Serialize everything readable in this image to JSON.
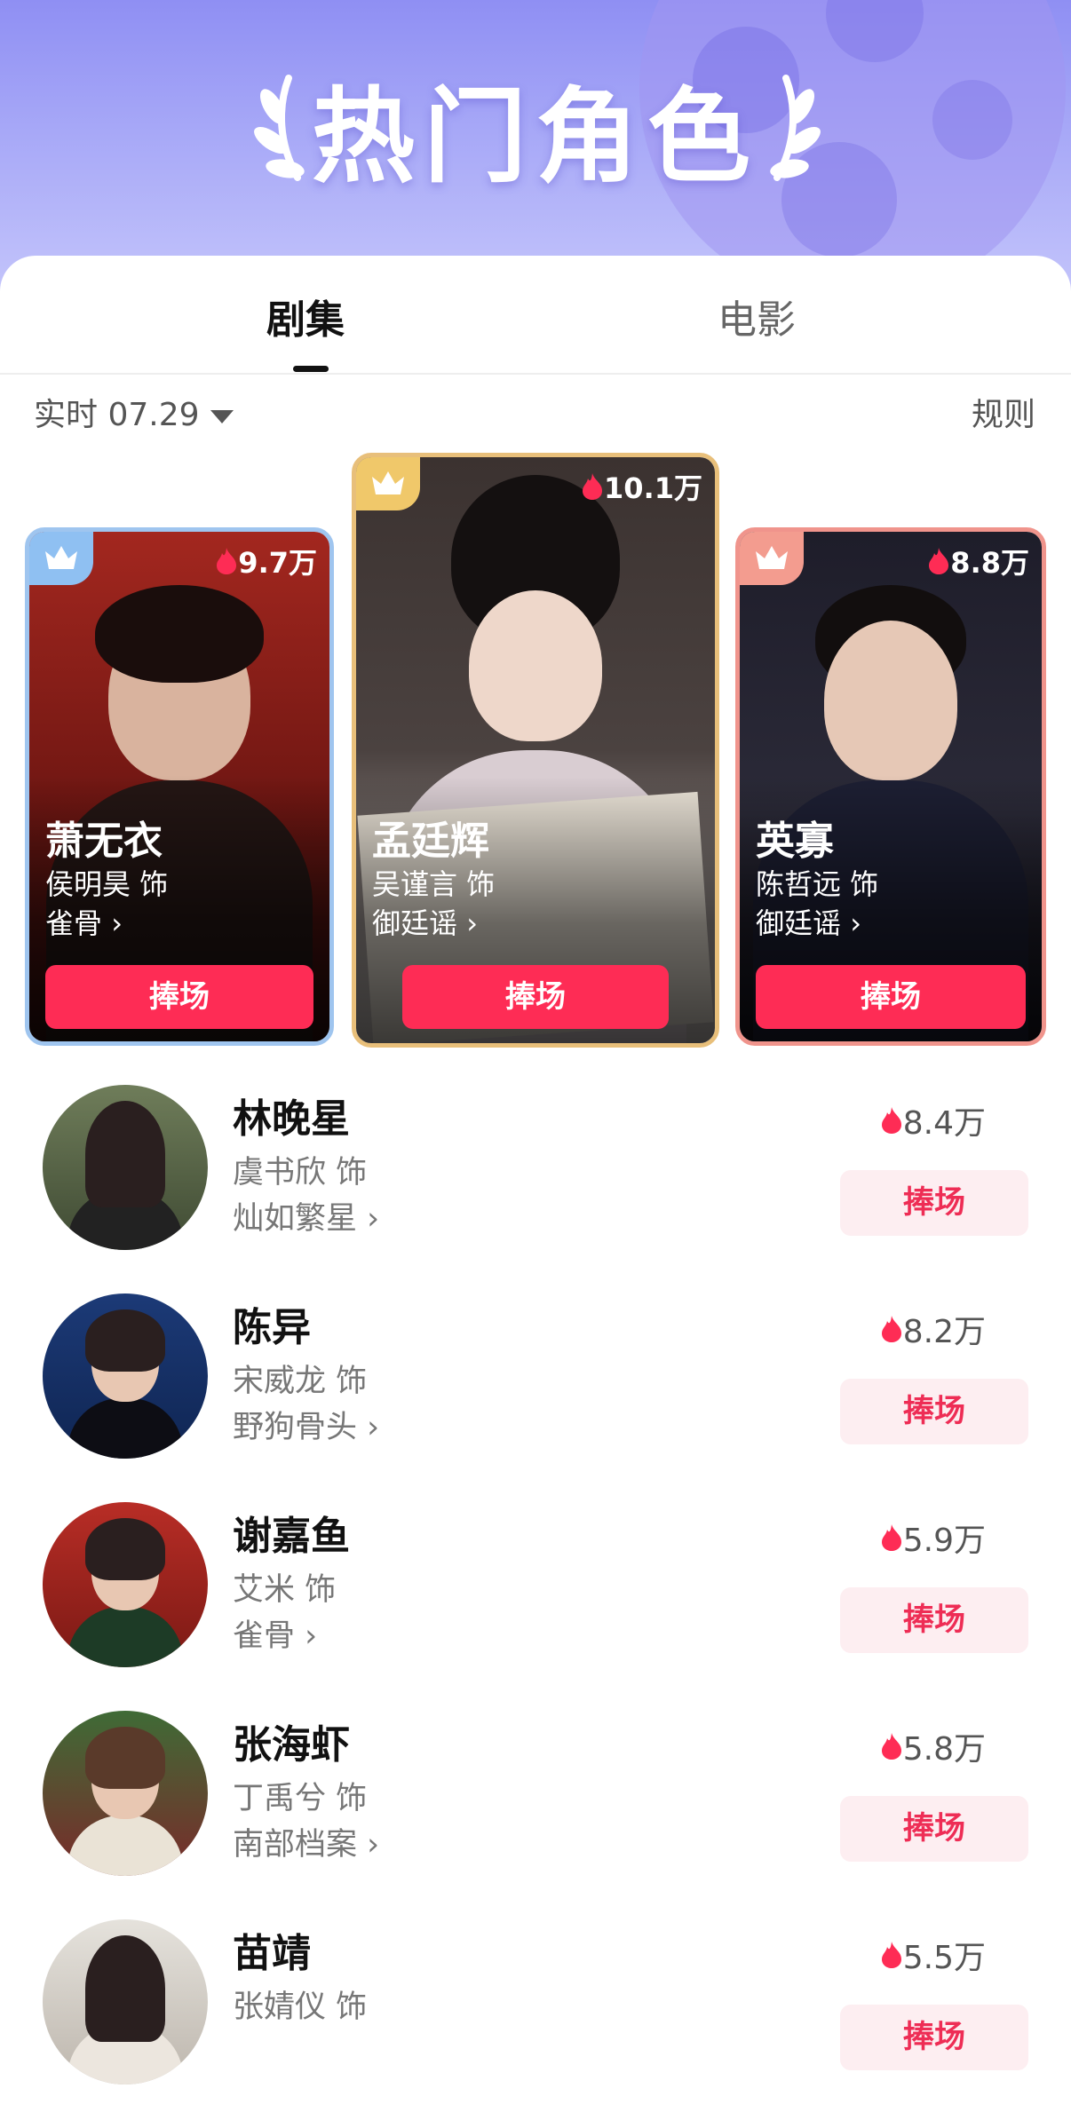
{
  "banner": {
    "title": "热门角色"
  },
  "tabs": [
    {
      "label": "剧集",
      "active": true
    },
    {
      "label": "电影",
      "active": false
    }
  ],
  "filter": {
    "label": "实时 07.29",
    "rules_label": "规则"
  },
  "colors": {
    "accent": "#fe2c55",
    "button_light_bg": "#fdeef1",
    "gold_frame": "#e8bf7a",
    "silver_frame": "#9fc5ef",
    "bronze_frame": "#f0948c"
  },
  "top_cards": [
    {
      "rank": 2,
      "name": "萧无衣",
      "actor": "侯明昊 饰",
      "show": "雀骨",
      "heat": "9.7万",
      "button": "捧场"
    },
    {
      "rank": 1,
      "name": "孟廷辉",
      "actor": "吴谨言 饰",
      "show": "御廷谣",
      "heat": "10.1万",
      "button": "捧场"
    },
    {
      "rank": 3,
      "name": "英寡",
      "actor": "陈哲远 饰",
      "show": "御廷谣",
      "heat": "8.8万",
      "button": "捧场"
    }
  ],
  "list": [
    {
      "name": "林晚星",
      "actor": "虞书欣 饰",
      "show": "灿如繁星",
      "heat": "8.4万",
      "button": "捧场"
    },
    {
      "name": "陈异",
      "actor": "宋威龙 饰",
      "show": "野狗骨头",
      "heat": "8.2万",
      "button": "捧场"
    },
    {
      "name": "谢嘉鱼",
      "actor": "艾米 饰",
      "show": "雀骨",
      "heat": "5.9万",
      "button": "捧场"
    },
    {
      "name": "张海虾",
      "actor": "丁禹兮 饰",
      "show": "南部档案",
      "heat": "5.8万",
      "button": "捧场"
    },
    {
      "name": "苗靖",
      "actor": "张婧仪 饰",
      "show": "",
      "heat": "5.5万",
      "button": "捧场"
    }
  ]
}
